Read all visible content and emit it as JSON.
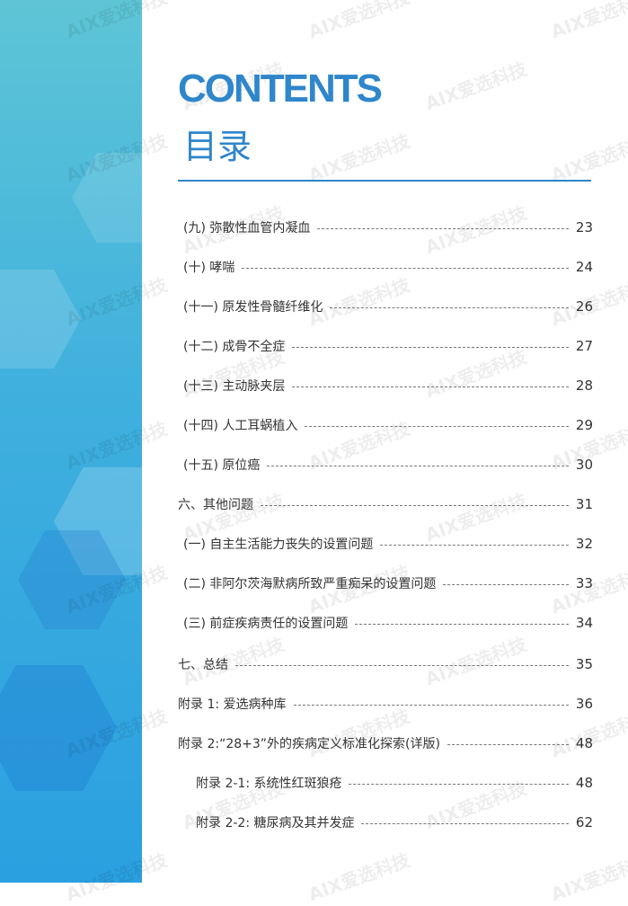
{
  "header": {
    "title": "CONTENTS",
    "subtitle": "目录"
  },
  "watermark": "AIX爱选科技",
  "entries": [
    {
      "label": "(九) 弥散性血管内凝血",
      "page": "23"
    },
    {
      "label": "(十) 哮喘",
      "page": "24"
    },
    {
      "label": "(十一) 原发性骨髓纤维化",
      "page": "26"
    },
    {
      "label": "(十二) 成骨不全症",
      "page": "27"
    },
    {
      "label": "(十三) 主动脉夹层",
      "page": "28"
    },
    {
      "label": "(十四) 人工耳蜗植入",
      "page": "29"
    },
    {
      "label": "(十五) 原位癌",
      "page": "30"
    },
    {
      "label": "六、其他问题",
      "page": "31"
    },
    {
      "label": "(一) 自主生活能力丧失的设置问题",
      "page": "32"
    },
    {
      "label": "(二) 非阿尔茨海默病所致严重痴呆的设置问题",
      "page": "33"
    },
    {
      "label": "(三) 前症疾病责任的设置问题",
      "page": "34"
    },
    {
      "label": "七、总结",
      "page": "35"
    },
    {
      "label": "附录 1: 爱选病种库",
      "page": "36"
    },
    {
      "label": "附录 2:“28+3”外的疾病定义标准化探索(详版)",
      "page": "48"
    },
    {
      "label": "附录 2-1: 系统性红斑狼疮",
      "page": "48"
    },
    {
      "label": "附录 2-2: 糖尿病及其并发症",
      "page": "62"
    }
  ]
}
